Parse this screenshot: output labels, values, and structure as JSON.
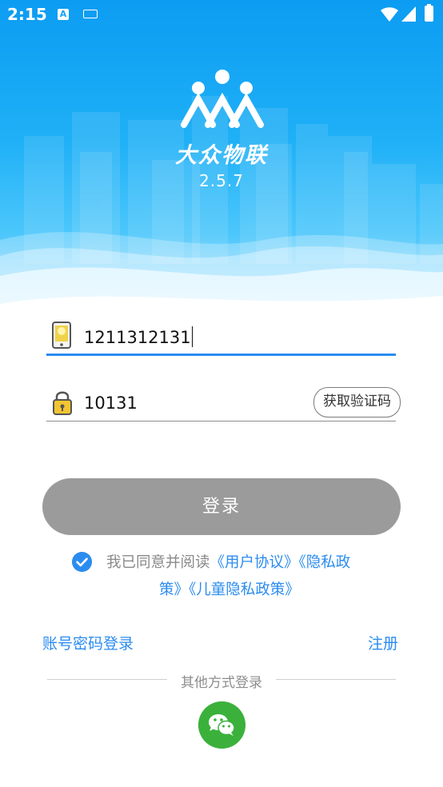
{
  "status_bar": {
    "time": "2:15",
    "a_icon": "A",
    "icons": [
      "font-a-icon",
      "keyboard-icon",
      "wifi-icon",
      "signal-icon",
      "battery-icon"
    ]
  },
  "brand": {
    "name": "大众物联",
    "version": "2.5.7",
    "colors": {
      "primary": "#2b8cf0",
      "sky": "#0c9cf2",
      "button_disabled": "#9b9b9b",
      "wechat": "#3bb13c"
    }
  },
  "phone_field": {
    "value": "1211312131",
    "icon": "phone-icon"
  },
  "code_field": {
    "value": "10131",
    "icon": "lock-icon",
    "get_code_label": "获取验证码"
  },
  "login_button": {
    "label": "登录"
  },
  "agreement": {
    "checked": true,
    "prefix": "我已同意并阅读",
    "user_agreement": "《用户协议》",
    "privacy_part1": "《隐私政",
    "privacy_part2": "策》",
    "child_privacy": "《儿童隐私政策》"
  },
  "links": {
    "password_login": "账号密码登录",
    "register": "注册"
  },
  "other_login": {
    "label": "其他方式登录",
    "wechat_icon": "wechat-icon"
  }
}
